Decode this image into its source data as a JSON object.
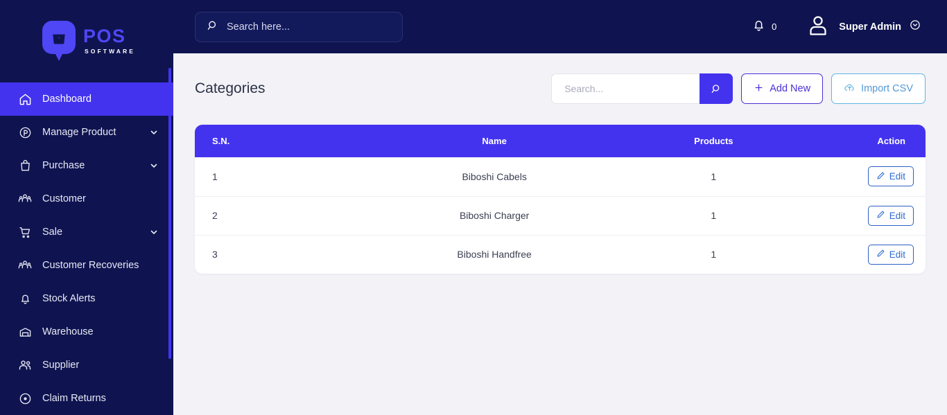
{
  "brand": {
    "name": "POS",
    "subtitle": "SOFTWARE",
    "accent": "#4F46F5"
  },
  "sidebar": {
    "items": [
      {
        "label": "Dashboard",
        "icon": "home-icon",
        "active": true,
        "caret": false
      },
      {
        "label": "Manage Product",
        "icon": "product-circle-p-icon",
        "active": false,
        "caret": true
      },
      {
        "label": "Purchase",
        "icon": "shopping-bag-icon",
        "active": false,
        "caret": true
      },
      {
        "label": "Customer",
        "icon": "customer-group-icon",
        "active": false,
        "caret": false
      },
      {
        "label": "Sale",
        "icon": "shopping-cart-icon",
        "active": false,
        "caret": true
      },
      {
        "label": "Customer Recoveries",
        "icon": "customer-group-icon",
        "active": false,
        "caret": false
      },
      {
        "label": "Stock Alerts",
        "icon": "bell-icon",
        "active": false,
        "caret": false
      },
      {
        "label": "Warehouse",
        "icon": "warehouse-icon",
        "active": false,
        "caret": false
      },
      {
        "label": "Supplier",
        "icon": "users-icon",
        "active": false,
        "caret": false
      },
      {
        "label": "Claim Returns",
        "icon": "target-dot-icon",
        "active": false,
        "caret": false
      }
    ]
  },
  "topbar": {
    "search_placeholder": "Search here...",
    "search_value": "",
    "notification_count": "0",
    "user_name": "Super Admin"
  },
  "page": {
    "title": "Categories"
  },
  "toolbar": {
    "search_placeholder": "Search...",
    "search_value": "",
    "add_new_label": "Add New",
    "import_csv_label": "Import CSV"
  },
  "table": {
    "headers": [
      "S.N.",
      "Name",
      "Products",
      "Action"
    ],
    "rows": [
      {
        "sn": "1",
        "name": "Biboshi Cabels",
        "products": "1",
        "action": "Edit"
      },
      {
        "sn": "2",
        "name": "Biboshi Charger",
        "products": "1",
        "action": "Edit"
      },
      {
        "sn": "3",
        "name": "Biboshi Handfree",
        "products": "1",
        "action": "Edit"
      }
    ]
  },
  "colors": {
    "sidebar_bg": "#0F1450",
    "active_nav": "#4433EE",
    "table_header": "#4433EE",
    "content_bg": "#F2F2F7",
    "edit_blue": "#2E6BD4",
    "import_teal": "#5499D8"
  }
}
